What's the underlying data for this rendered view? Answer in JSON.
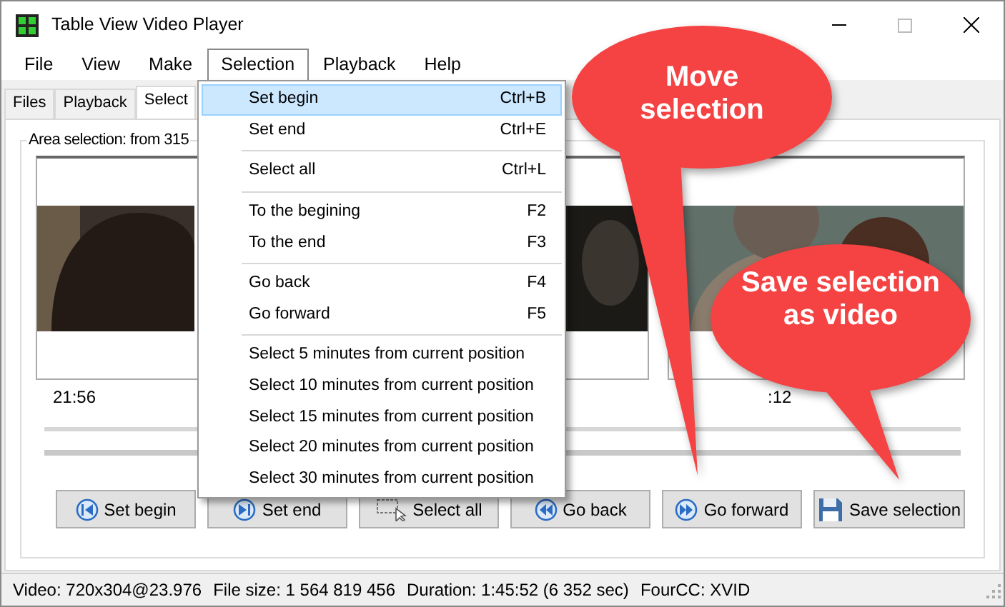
{
  "window": {
    "title": "Table View Video Player"
  },
  "menu_bar": [
    {
      "label": "File",
      "selected": false
    },
    {
      "label": "View",
      "selected": false
    },
    {
      "label": "Make",
      "selected": false
    },
    {
      "label": "Selection",
      "selected": true
    },
    {
      "label": "Playback",
      "selected": false
    },
    {
      "label": "Help",
      "selected": false
    }
  ],
  "tabs": [
    {
      "label": "Files",
      "selected": false
    },
    {
      "label": "Playback",
      "selected": false
    },
    {
      "label": "Select",
      "selected": true
    }
  ],
  "group_title": "Area selection: from 315",
  "frames": [
    {
      "kind": "picture",
      "time": "21:56"
    },
    {
      "kind": "picture"
    },
    {
      "kind": "picture",
      "time": ":12"
    }
  ],
  "buttons": [
    "Set begin",
    "Set end",
    "Select all",
    "Go back",
    "Go forward",
    "Save selection"
  ],
  "dropdown": {
    "groups": [
      [
        {
          "label": "Set begin",
          "shortcut": "Ctrl+B",
          "selected": true
        },
        {
          "label": "Set end",
          "shortcut": "Ctrl+E",
          "selected": false
        }
      ],
      [
        {
          "label": "Select all",
          "shortcut": "Ctrl+L",
          "selected": false
        }
      ],
      [
        {
          "label": "To the begining",
          "shortcut": "F2",
          "selected": false
        },
        {
          "label": "To the end",
          "shortcut": "F3",
          "selected": false
        }
      ],
      [
        {
          "label": "Go back",
          "shortcut": "F4",
          "selected": false
        },
        {
          "label": "Go forward",
          "shortcut": "F5",
          "selected": false
        }
      ],
      [
        {
          "label": "Select 5 minutes from current position",
          "selected": false
        },
        {
          "label": "Select 10 minutes from current position",
          "selected": false
        },
        {
          "label": "Select 15 minutes from current position",
          "selected": false
        },
        {
          "label": "Select 20 minutes from current position",
          "selected": false
        },
        {
          "label": "Select 30 minutes from current position",
          "selected": false
        }
      ]
    ]
  },
  "callouts": [
    "Move selection",
    "Save selection as video"
  ],
  "status_bar": [
    "Video: 720x304@23.976",
    "File size: 1 564 819 456",
    "Duration: 1:45:52 (6 352 sec)",
    "FourCC: XVID"
  ]
}
